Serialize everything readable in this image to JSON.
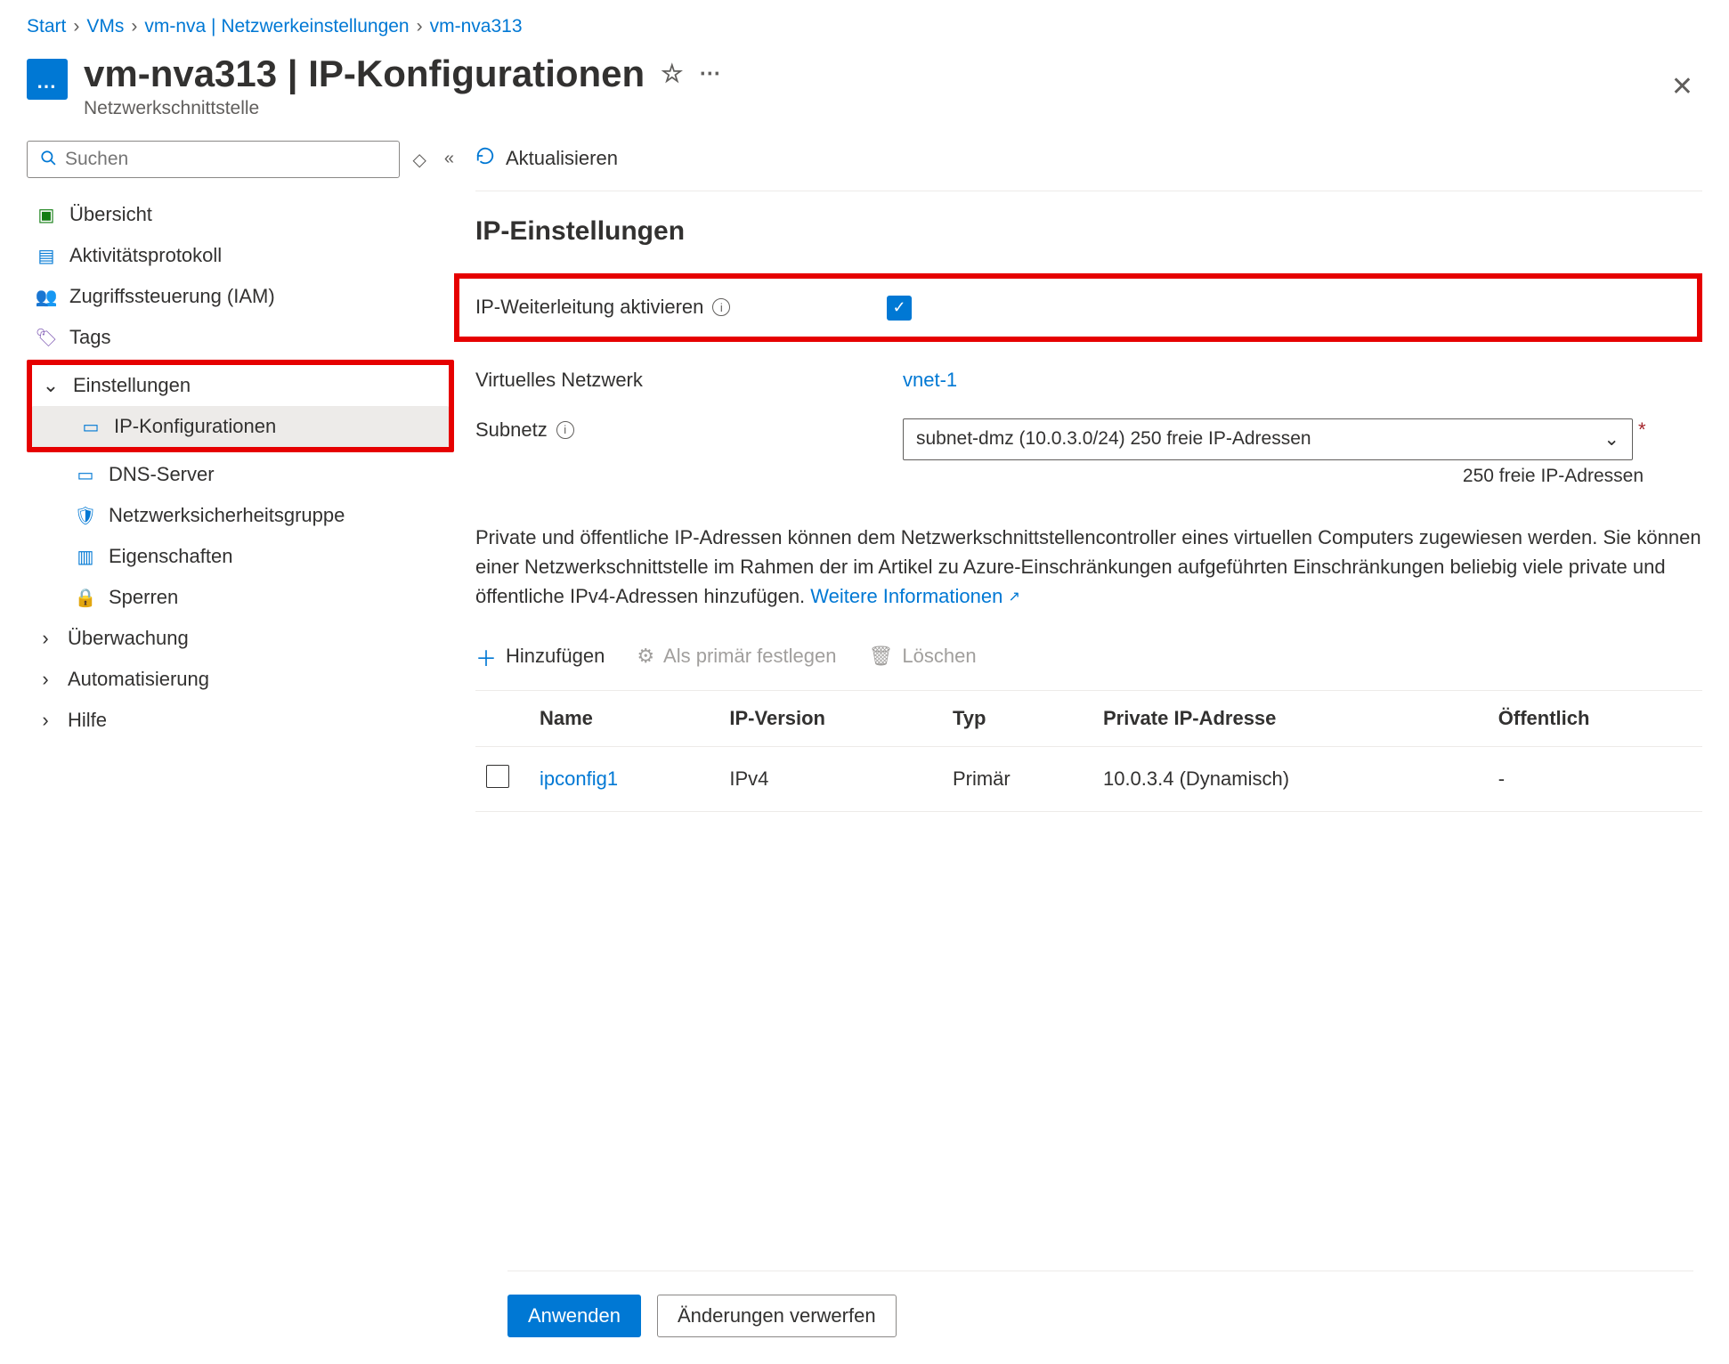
{
  "breadcrumb": {
    "items": [
      "Start",
      "VMs",
      "vm-nva | Netzwerkeinstellungen",
      "vm-nva313"
    ]
  },
  "header": {
    "title": "vm-nva313 | IP-Konfigurationen",
    "subtitle": "Netzwerkschnittstelle"
  },
  "sidebar": {
    "search_placeholder": "Suchen",
    "items": {
      "overview": "Übersicht",
      "activity": "Aktivitätsprotokoll",
      "iam": "Zugriffssteuerung (IAM)",
      "tags": "Tags",
      "settings_group": "Einstellungen",
      "ipconfig": "IP-Konfigurationen",
      "dns": "DNS-Server",
      "nsg": "Netzwerksicherheitsgruppe",
      "properties": "Eigenschaften",
      "locks": "Sperren",
      "monitoring_group": "Überwachung",
      "automation_group": "Automatisierung",
      "help_group": "Hilfe"
    }
  },
  "main": {
    "refresh": "Aktualisieren",
    "section_title": "IP-Einstellungen",
    "ip_forward_label": "IP-Weiterleitung aktivieren",
    "vnet_label": "Virtuelles Netzwerk",
    "vnet_value": "vnet-1",
    "subnet_label": "Subnetz",
    "subnet_value": "subnet-dmz (10.0.3.0/24) 250 freie IP-Adressen",
    "subnet_helper": "250 freie IP-Adressen",
    "description": "Private und öffentliche IP-Adressen können dem Netzwerkschnittstellencontroller eines virtuellen Computers zugewiesen werden. Sie können einer Netzwerkschnittstelle im Rahmen der im Artikel zu Azure-Einschränkungen aufgeführten Einschränkungen beliebig viele private und öffentliche IPv4-Adressen hinzufügen.",
    "learn_more": "Weitere Informationen",
    "toolbar": {
      "add": "Hinzufügen",
      "set_primary": "Als primär festlegen",
      "delete": "Löschen"
    },
    "table": {
      "cols": {
        "name": "Name",
        "ipver": "IP-Version",
        "type": "Typ",
        "priv": "Private IP-Adresse",
        "pub": "Öffentlich"
      },
      "rows": [
        {
          "name": "ipconfig1",
          "ipver": "IPv4",
          "type": "Primär",
          "priv": "10.0.3.4 (Dynamisch)",
          "pub": "-"
        }
      ]
    }
  },
  "footer": {
    "apply": "Anwenden",
    "discard": "Änderungen verwerfen"
  }
}
